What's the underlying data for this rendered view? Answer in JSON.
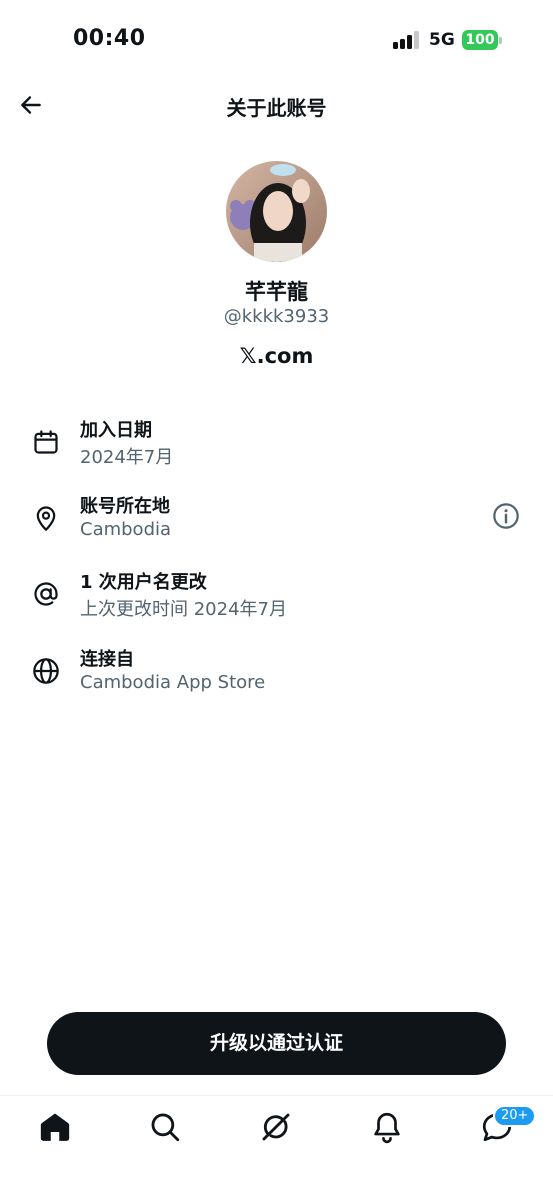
{
  "status_bar": {
    "time": "00:40",
    "network": "5G",
    "battery": "100"
  },
  "header": {
    "title": "关于此账号",
    "back_icon": "arrow-left-icon"
  },
  "profile": {
    "display_name": "芊芊龍",
    "handle": "@kkkk3933",
    "site": "𝕏.com"
  },
  "info": {
    "joined": {
      "label": "加入日期",
      "value": "2024年7月",
      "icon": "calendar-icon"
    },
    "location": {
      "label": "账号所在地",
      "value": "Cambodia",
      "icon": "location-pin-icon"
    },
    "username_changes": {
      "label": "1 次用户名更改",
      "value": "上次更改时间 2024年7月",
      "icon": "at-sign-icon"
    },
    "connected_via": {
      "label": "连接自",
      "value": "Cambodia App Store",
      "icon": "globe-icon"
    }
  },
  "cta": {
    "label": "升级以通过认证"
  },
  "tab_bar": {
    "items": [
      "home-icon",
      "search-icon",
      "grok-icon",
      "notifications-icon",
      "messages-icon"
    ],
    "messages_badge": "20+"
  },
  "colors": {
    "primary_text": "#0f1419",
    "secondary_text": "#536471",
    "accent": "#1d9bf0",
    "battery": "#34c759"
  }
}
